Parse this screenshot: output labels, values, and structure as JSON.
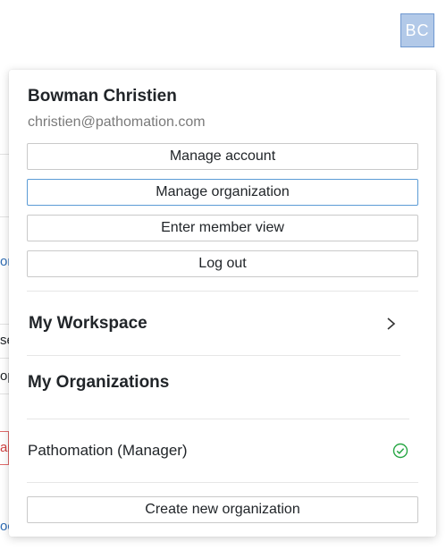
{
  "header": {
    "avatar_initials": "BC"
  },
  "background_fragments": [
    "or",
    "se",
    "op",
    "ar",
    "oc"
  ],
  "user": {
    "name": "Bowman Christien",
    "email": "christien@pathomation.com"
  },
  "actions": {
    "manage_account": "Manage account",
    "manage_organization": "Manage organization",
    "enter_member_view": "Enter member view",
    "log_out": "Log out"
  },
  "workspace": {
    "title": "My Workspace",
    "icon": "chevron-right-icon"
  },
  "organizations": {
    "title": "My Organizations",
    "items": [
      {
        "label": "Pathomation (Manager)",
        "active": true,
        "icon": "check-circle-icon"
      }
    ],
    "create_label": "Create new organization"
  },
  "colors": {
    "avatar_bg": "#b2c9e8",
    "focus_border": "#5b9bd5",
    "check_green": "#28a745",
    "email_gray": "#7a7a7a"
  }
}
